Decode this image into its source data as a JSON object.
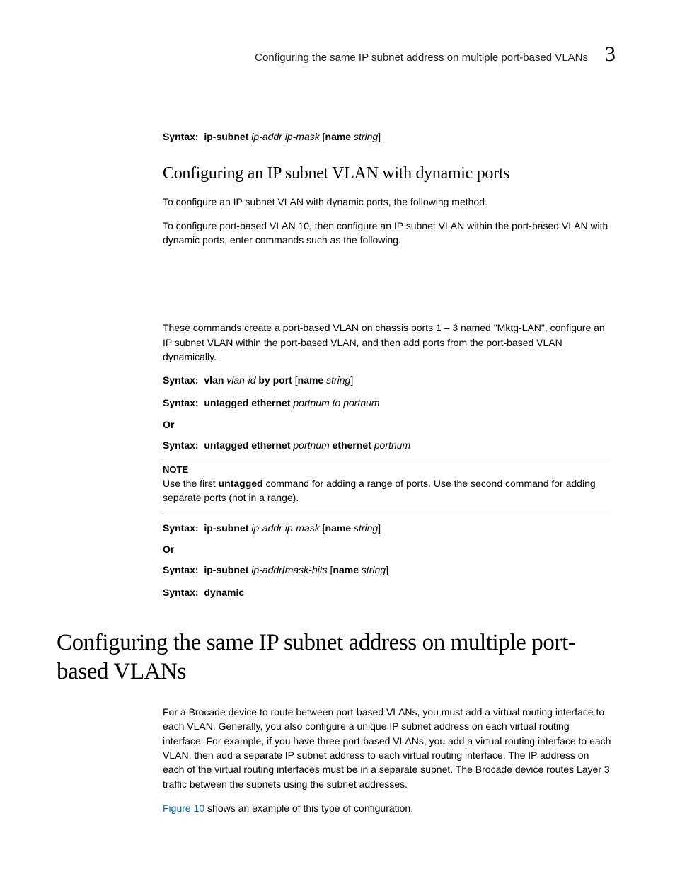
{
  "header": {
    "title": "Configuring the same IP subnet address on multiple port-based VLANs",
    "chapter": "3"
  },
  "syntax1": {
    "prefix": "Syntax:",
    "cmd": "ip-subnet",
    "args1": "ip-addr ip-mask",
    "open": "[",
    "optcmd": "name",
    "optarg": "string",
    "close": "]"
  },
  "subhead": "Configuring an IP subnet VLAN with dynamic ports",
  "p1": "To configure an IP subnet VLAN with dynamic ports, the following method.",
  "p2": "To configure port-based VLAN 10, then configure an IP subnet VLAN within the port-based VLAN with dynamic ports, enter commands such as the following.",
  "p3": "These commands create a port-based VLAN on chassis ports 1 – 3 named \"Mktg-LAN\", configure an IP subnet VLAN within the port-based VLAN, and then add ports from the port-based VLAN dynamically.",
  "syntax2": {
    "prefix": "Syntax:",
    "cmd1": "vlan",
    "arg1": "vlan-id",
    "cmd2": "by port",
    "open": "[",
    "optcmd": "name",
    "optarg": "string",
    "close": "]"
  },
  "syntax3": {
    "prefix": "Syntax:",
    "cmd": "untagged ethernet",
    "arg1": "portnum to portnum"
  },
  "or": "Or",
  "syntax4": {
    "prefix": "Syntax:",
    "cmd1": "untagged ethernet",
    "arg1": "portnum",
    "cmd2": "ethernet",
    "arg2": "portnum"
  },
  "note": {
    "title": "NOTE",
    "pre": "Use the first ",
    "bold": "untagged",
    "post": " command for adding a range of ports. Use the second command for adding separate ports (not in a range)."
  },
  "syntax5": {
    "prefix": "Syntax:",
    "cmd": "ip-subnet",
    "arg1": "ip-addr ip-mask",
    "open": "[",
    "optcmd": "name",
    "optarg": "string",
    "close": "]"
  },
  "syntax6": {
    "prefix": "Syntax:",
    "cmd": "ip-subnet",
    "arg1": "ip-addr",
    "slash": "/",
    "arg2": "mask-bits",
    "open": "[",
    "optcmd": "name",
    "optarg": "string",
    "close": "]"
  },
  "syntax7": {
    "prefix": "Syntax:",
    "cmd": "dynamic"
  },
  "section_head": "Configuring the same IP subnet address on multiple port-based VLANs",
  "p4": "For a Brocade device to route between port-based VLANs, you must add a virtual routing interface to each VLAN. Generally, you also configure a unique IP subnet address on each virtual routing interface. For example, if you have three port-based VLANs, you add a virtual routing interface to each VLAN, then add a separate IP subnet address to each virtual routing interface. The IP address on each of the virtual routing interfaces must be in a separate subnet. The Brocade device routes Layer 3 traffic between the subnets using the subnet addresses.",
  "p5_link": "Figure 10",
  "p5_rest": " shows an example of this type of configuration."
}
